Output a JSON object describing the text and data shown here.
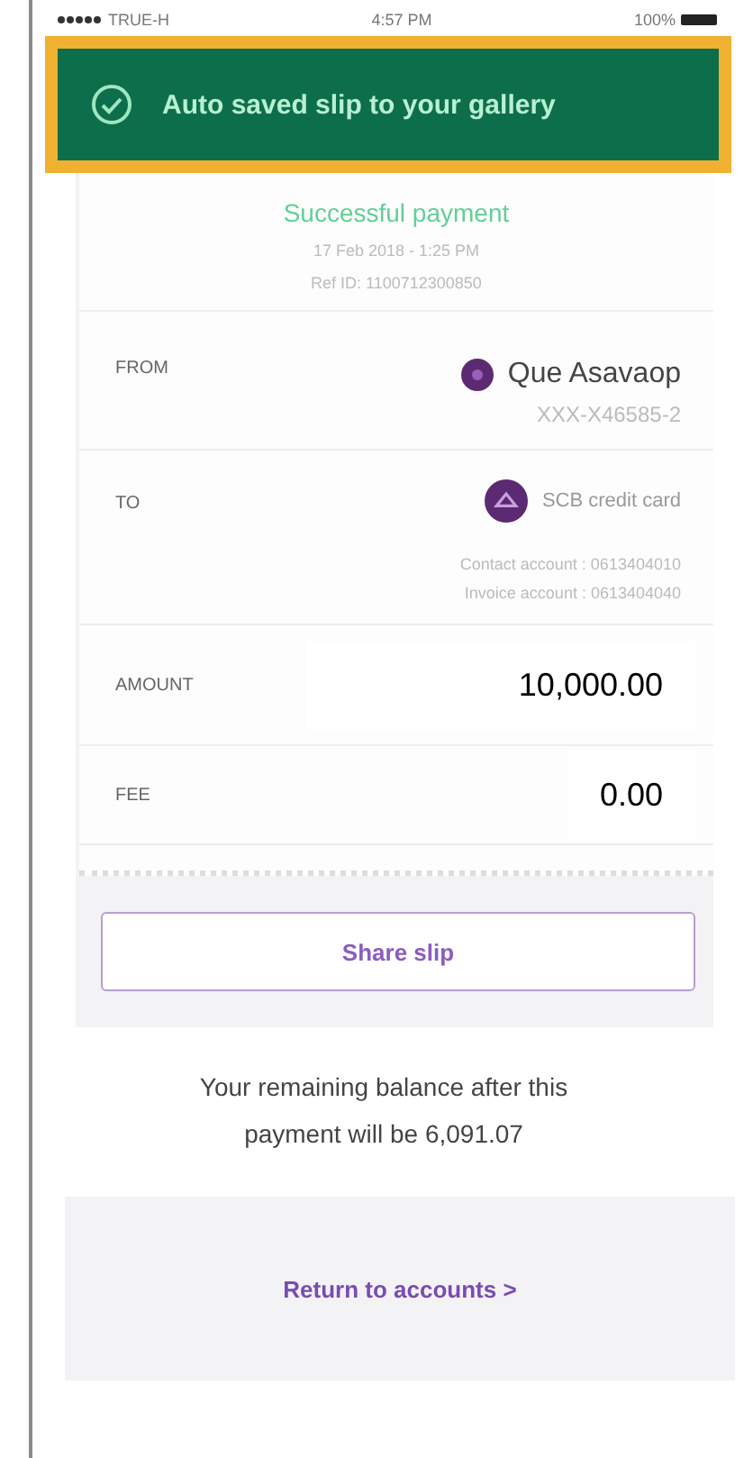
{
  "status_bar": {
    "carrier": "TRUE-H",
    "time": "4:57 PM",
    "battery": "100%"
  },
  "toast": {
    "message": "Auto saved slip to your gallery"
  },
  "slip": {
    "status": "Successful payment",
    "date": "17 Feb 2018 - 1:25 PM",
    "ref": "Ref ID: 1100712300850",
    "from": {
      "label": "FROM",
      "name": "Que Asavaop",
      "account": "XXX-X46585-2"
    },
    "to": {
      "label": "TO",
      "name": "SCB credit card",
      "lines": [
        "Contact account : 0613404010",
        "Invoice account : 0613404040"
      ]
    },
    "amount": {
      "label": "AMOUNT",
      "value": "10,000.00"
    },
    "fee": {
      "label": "FEE",
      "value": "0.00"
    },
    "share_button": "Share slip"
  },
  "balance_note": "Your remaining balance after this payment  will be 6,091.07",
  "return_link": "Return to accounts >"
}
